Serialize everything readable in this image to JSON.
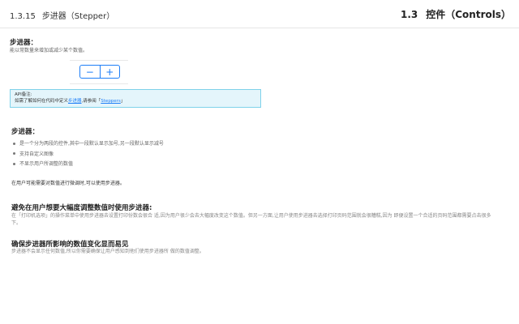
{
  "header": {
    "section_number": "1.3.15",
    "section_title": "步进器（Stepper）",
    "chapter_number": "1.3",
    "chapter_title": "控件（Controls）"
  },
  "intro": {
    "title": "步进器：",
    "description": "能以常数量来增加或减少某个数值。"
  },
  "stepper": {
    "minus_symbol": "−",
    "plus_symbol": "+"
  },
  "api_note": {
    "label": "API备注:",
    "text_before": "如需了解如何在代码中定义",
    "link1": "步进器",
    "text_middle": ",请参阅「",
    "link2": "Steppers",
    "text_after": "」"
  },
  "section1": {
    "title": "步进器：",
    "bullets": [
      "是一个分为两段的控件,其中一段默认显示加号,另一段默认显示减号",
      "支持自定义图像",
      "不显示用户所调整的数值"
    ]
  },
  "usage_text": "在用户可能需要对数值进行微调时,可以使用步进器。",
  "section2": {
    "title": "避免在用户想要大幅度调整数值时使用步进器:",
    "text": "在「打印机选项」的操作菜单中使用步进器去设置打印份数会很合 适,因为用户很少会去大幅度改变这个数值。但另一方面,让用户使用步进器去选择打印页码范围就会很糟糕,因为 即便设置一个合适的页码范围都需要点击很多下。"
  },
  "section3": {
    "title": "确保步进器所影响的数值变化显而易见",
    "text": "步进器不会显示任何数值,所以你需要确保让用户感知到他们使用步进器所 做的数值调整。"
  }
}
